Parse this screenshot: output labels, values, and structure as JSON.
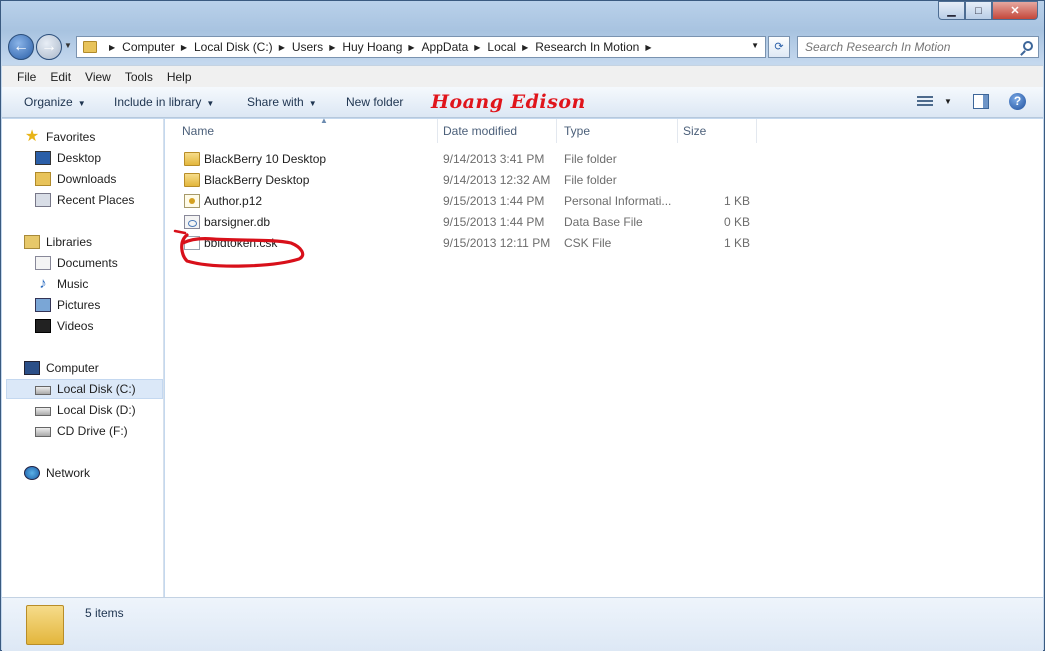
{
  "window": {
    "controls": {
      "minimize": "▁",
      "maximize": "□",
      "close": "✕"
    }
  },
  "address": {
    "crumbs": [
      "Computer",
      "Local Disk (C:)",
      "Users",
      "Huy Hoang",
      "AppData",
      "Local",
      "Research In Motion"
    ],
    "search_placeholder": "Search Research In Motion"
  },
  "menu": [
    "File",
    "Edit",
    "View",
    "Tools",
    "Help"
  ],
  "toolbar": {
    "organize": "Organize",
    "include": "Include in library",
    "share": "Share with",
    "new_folder": "New folder",
    "watermark": "Hoang Edison"
  },
  "nav": {
    "favorites": "Favorites",
    "desktop": "Desktop",
    "downloads": "Downloads",
    "recent": "Recent Places",
    "libraries": "Libraries",
    "documents": "Documents",
    "music": "Music",
    "pictures": "Pictures",
    "videos": "Videos",
    "computer": "Computer",
    "local_c": "Local Disk (C:)",
    "local_d": "Local Disk (D:)",
    "cd": "CD Drive (F:)",
    "network": "Network"
  },
  "columns": {
    "name": "Name",
    "date": "Date modified",
    "type": "Type",
    "size": "Size"
  },
  "files": [
    {
      "name": "BlackBerry 10 Desktop",
      "date": "9/14/2013 3:41 PM",
      "type": "File folder",
      "size": "",
      "icon": "folder-icon"
    },
    {
      "name": "BlackBerry Desktop",
      "date": "9/14/2013 12:32 AM",
      "type": "File folder",
      "size": "",
      "icon": "folder-icon"
    },
    {
      "name": "Author.p12",
      "date": "9/15/2013 1:44 PM",
      "type": "Personal Informati...",
      "size": "1 KB",
      "icon": "certificate-icon"
    },
    {
      "name": "barsigner.db",
      "date": "9/15/2013 1:44 PM",
      "type": "Data Base File",
      "size": "0 KB",
      "icon": "database-file-icon"
    },
    {
      "name": "bbidtoken.csk",
      "date": "9/15/2013 12:11 PM",
      "type": "CSK File",
      "size": "1 KB",
      "icon": "file-icon"
    }
  ],
  "status": {
    "count": "5 items"
  },
  "accent": {
    "watermark": "#e0141b",
    "selection": "#dbe8f8",
    "frame": "#b9d1ea"
  }
}
